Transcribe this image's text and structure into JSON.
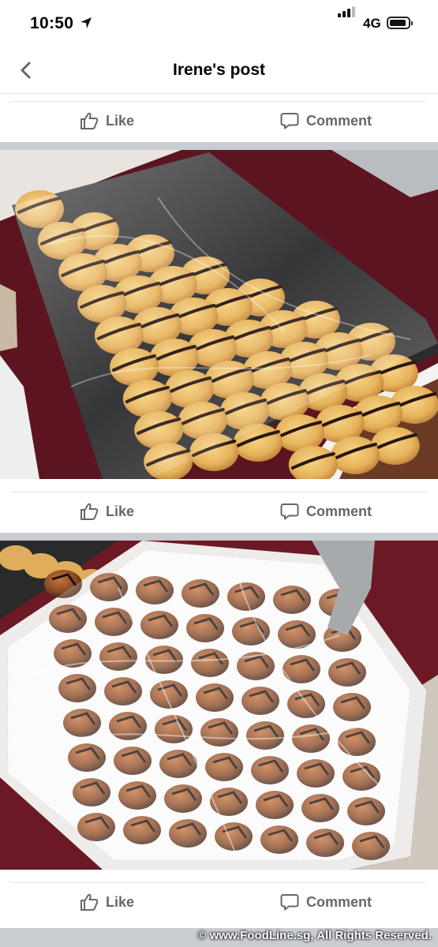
{
  "status": {
    "time": "10:50",
    "network": "4G"
  },
  "nav": {
    "title": "Irene's post"
  },
  "actions": {
    "like": "Like",
    "comment": "Comment"
  },
  "photos": [
    {
      "alt": "Tray of chocolate-drizzled cream puffs wrapped in cling film"
    },
    {
      "alt": "Tray of dark glazed pastries wrapped in cling film on a doily"
    }
  ],
  "watermark": "© www.FoodLine.sg, All Rights Reserved.",
  "colors": {
    "action_text": "#65676b",
    "separator": "#c9ccd1",
    "tablecloth": "#6b1a25"
  }
}
